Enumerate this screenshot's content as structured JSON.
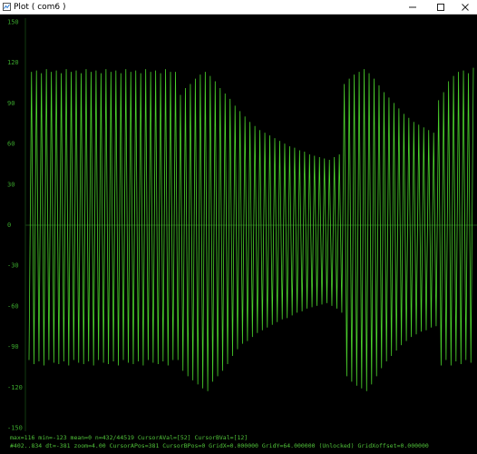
{
  "window": {
    "title": "Plot ( com6 )",
    "app_icon": "plot-app-icon",
    "controls": [
      "minimize-icon",
      "maximize-icon",
      "close-icon"
    ]
  },
  "colors": {
    "background": "#000000",
    "trace": "#4bd32c",
    "axis_text": "#3aa52c",
    "zero_line": "#1d4a16"
  },
  "chart_data": {
    "type": "line",
    "title": "",
    "xlabel": "",
    "ylabel": "",
    "ylim": [
      -150,
      150
    ],
    "y_ticks": [
      150,
      120,
      90,
      60,
      30,
      0,
      -30,
      -60,
      -90,
      -120,
      -150
    ],
    "y_tick_labels": [
      "150",
      "120",
      "90",
      "60",
      "30",
      "0",
      "-30",
      "-60",
      "-90",
      "-120",
      "-150"
    ],
    "grid": false,
    "x": [
      0,
      1,
      2,
      3,
      4,
      5,
      6,
      7,
      8,
      9,
      10,
      11,
      12,
      13,
      14,
      15,
      16,
      17,
      18,
      19,
      20,
      21,
      22,
      23,
      24,
      25,
      26,
      27,
      28,
      29,
      30,
      31,
      32,
      33,
      34,
      35,
      36,
      37,
      38,
      39,
      40,
      41,
      42,
      43,
      44,
      45,
      46,
      47,
      48,
      49,
      50,
      51,
      52,
      53,
      54,
      55,
      56,
      57,
      58,
      59,
      60,
      61,
      62,
      63,
      64,
      65,
      66,
      67,
      68,
      69,
      70,
      71,
      72,
      73,
      74,
      75,
      76,
      77,
      78,
      79,
      80,
      81,
      82,
      83,
      84,
      85,
      86,
      87,
      88,
      89,
      90,
      91,
      92,
      93,
      94,
      95,
      96,
      97,
      98,
      99,
      100,
      101,
      102,
      103,
      104,
      105,
      106,
      107,
      108,
      109,
      110,
      111,
      112,
      113,
      114,
      115,
      116,
      117,
      118,
      119,
      120,
      121,
      122,
      123,
      124,
      125,
      126,
      127,
      128,
      129,
      130,
      131,
      132,
      133,
      134,
      135,
      136,
      137,
      138,
      139,
      140,
      141,
      142,
      143,
      144,
      145,
      146,
      147,
      148,
      149,
      150,
      151,
      152,
      153,
      154,
      155,
      156,
      157,
      158,
      159,
      160,
      161,
      162,
      163,
      164,
      165,
      166,
      167,
      168,
      169,
      170,
      171,
      172,
      173,
      174,
      175,
      176,
      177,
      178,
      179
    ],
    "series": [
      {
        "values": [
          -100,
          113,
          -103,
          114,
          -101,
          112,
          -104,
          115,
          -100,
          113,
          -102,
          114,
          -103,
          112,
          -101,
          115,
          -104,
          113,
          -100,
          114,
          -102,
          112,
          -103,
          115,
          -101,
          113,
          -104,
          114,
          -100,
          112,
          -102,
          115,
          -103,
          113,
          -101,
          114,
          -104,
          112,
          -100,
          115,
          -102,
          113,
          -103,
          114,
          -101,
          112,
          -104,
          115,
          -100,
          113,
          -102,
          114,
          -103,
          112,
          -101,
          115,
          -104,
          113,
          -100,
          113,
          -100,
          96,
          -108,
          101,
          -112,
          104,
          -115,
          108,
          -118,
          111,
          -121,
          113,
          -123,
          110,
          -116,
          106,
          -112,
          101,
          -108,
          97,
          -103,
          93,
          -97,
          88,
          -92,
          84,
          -88,
          80,
          -86,
          76,
          -83,
          73,
          -80,
          70,
          -78,
          68,
          -76,
          66,
          -74,
          64,
          -72,
          62,
          -70,
          60,
          -69,
          58,
          -67,
          57,
          -65,
          55,
          -64,
          54,
          -62,
          52,
          -61,
          51,
          -60,
          50,
          -59,
          49,
          -58,
          48,
          -60,
          50,
          -62,
          52,
          -65,
          104,
          -112,
          108,
          -116,
          111,
          -119,
          113,
          -121,
          115,
          -123,
          112,
          -118,
          108,
          -112,
          103,
          -106,
          98,
          -101,
          94,
          -97,
          90,
          -93,
          86,
          -89,
          82,
          -86,
          79,
          -83,
          76,
          -81,
          74,
          -79,
          72,
          -78,
          70,
          -76,
          68,
          -75,
          92,
          -104,
          98,
          -100,
          106,
          -104,
          110,
          -101,
          113,
          -103,
          114,
          -100,
          112,
          -102,
          116,
          -104,
          113,
          -101,
          115
        ],
        "color": "#4bd32c"
      }
    ]
  },
  "status": {
    "line1": "max=116  min=-123  mean=0  n=432/44519  CursorAVal=[52]  CursorBVal=[12]",
    "line2": "#402..834  dt=-381 zoom=4.00  CursorAPos=381  CursorBPos=0  GridX=0.000000  GridY=64.000000  (Unlocked) GridXoffset=0.000000"
  }
}
